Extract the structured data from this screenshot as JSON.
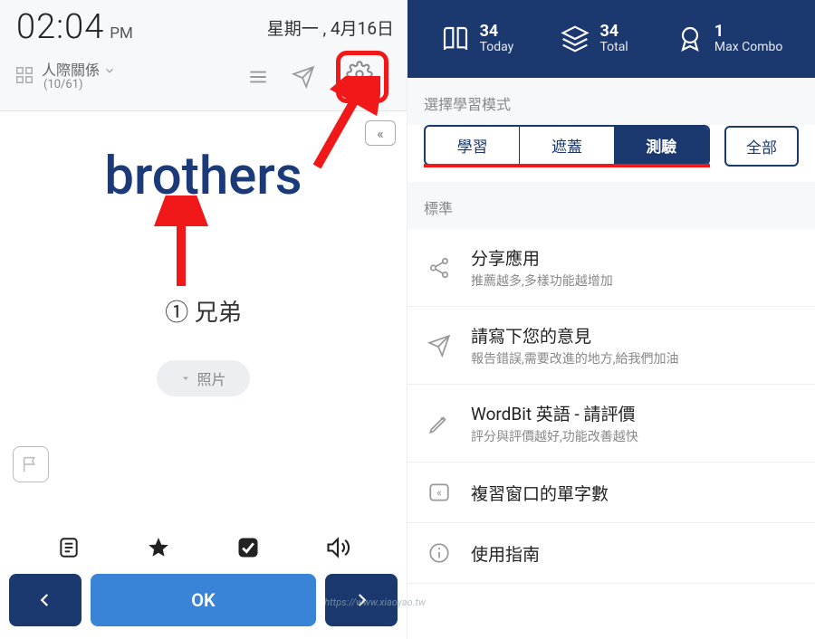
{
  "left": {
    "time": "02:04",
    "ampm": "PM",
    "date": "星期一 , 4月16日",
    "category": {
      "name": "人際關係",
      "count": "(10/61)"
    },
    "word": "brothers",
    "meaning": "① 兄弟",
    "photo_label": "照片",
    "ok_label": "OK",
    "review_glyph": "«"
  },
  "right": {
    "stats": {
      "today": {
        "num": "34",
        "label": "Today"
      },
      "total": {
        "num": "34",
        "label": "Total"
      },
      "combo": {
        "num": "1",
        "label": "Max Combo"
      }
    },
    "section_select_mode": "選擇學習模式",
    "modes": {
      "study": "學習",
      "cover": "遮蓋",
      "test": "測驗",
      "all": "全部"
    },
    "section_standard": "標準",
    "items": {
      "share": {
        "title": "分享應用",
        "sub": "推薦越多,多樣功能越增加"
      },
      "feedback": {
        "title": "請寫下您的意見",
        "sub": "報告錯誤,需要改進的地方,給我們加油"
      },
      "rate": {
        "title": "WordBit 英語 - 請評價",
        "sub": "評分與評價越好,功能改善越快"
      },
      "review": {
        "title": "複習窗口的單字數"
      },
      "guide": {
        "title": "使用指南"
      }
    }
  },
  "watermark": "https://www.xiaoyao.tw"
}
